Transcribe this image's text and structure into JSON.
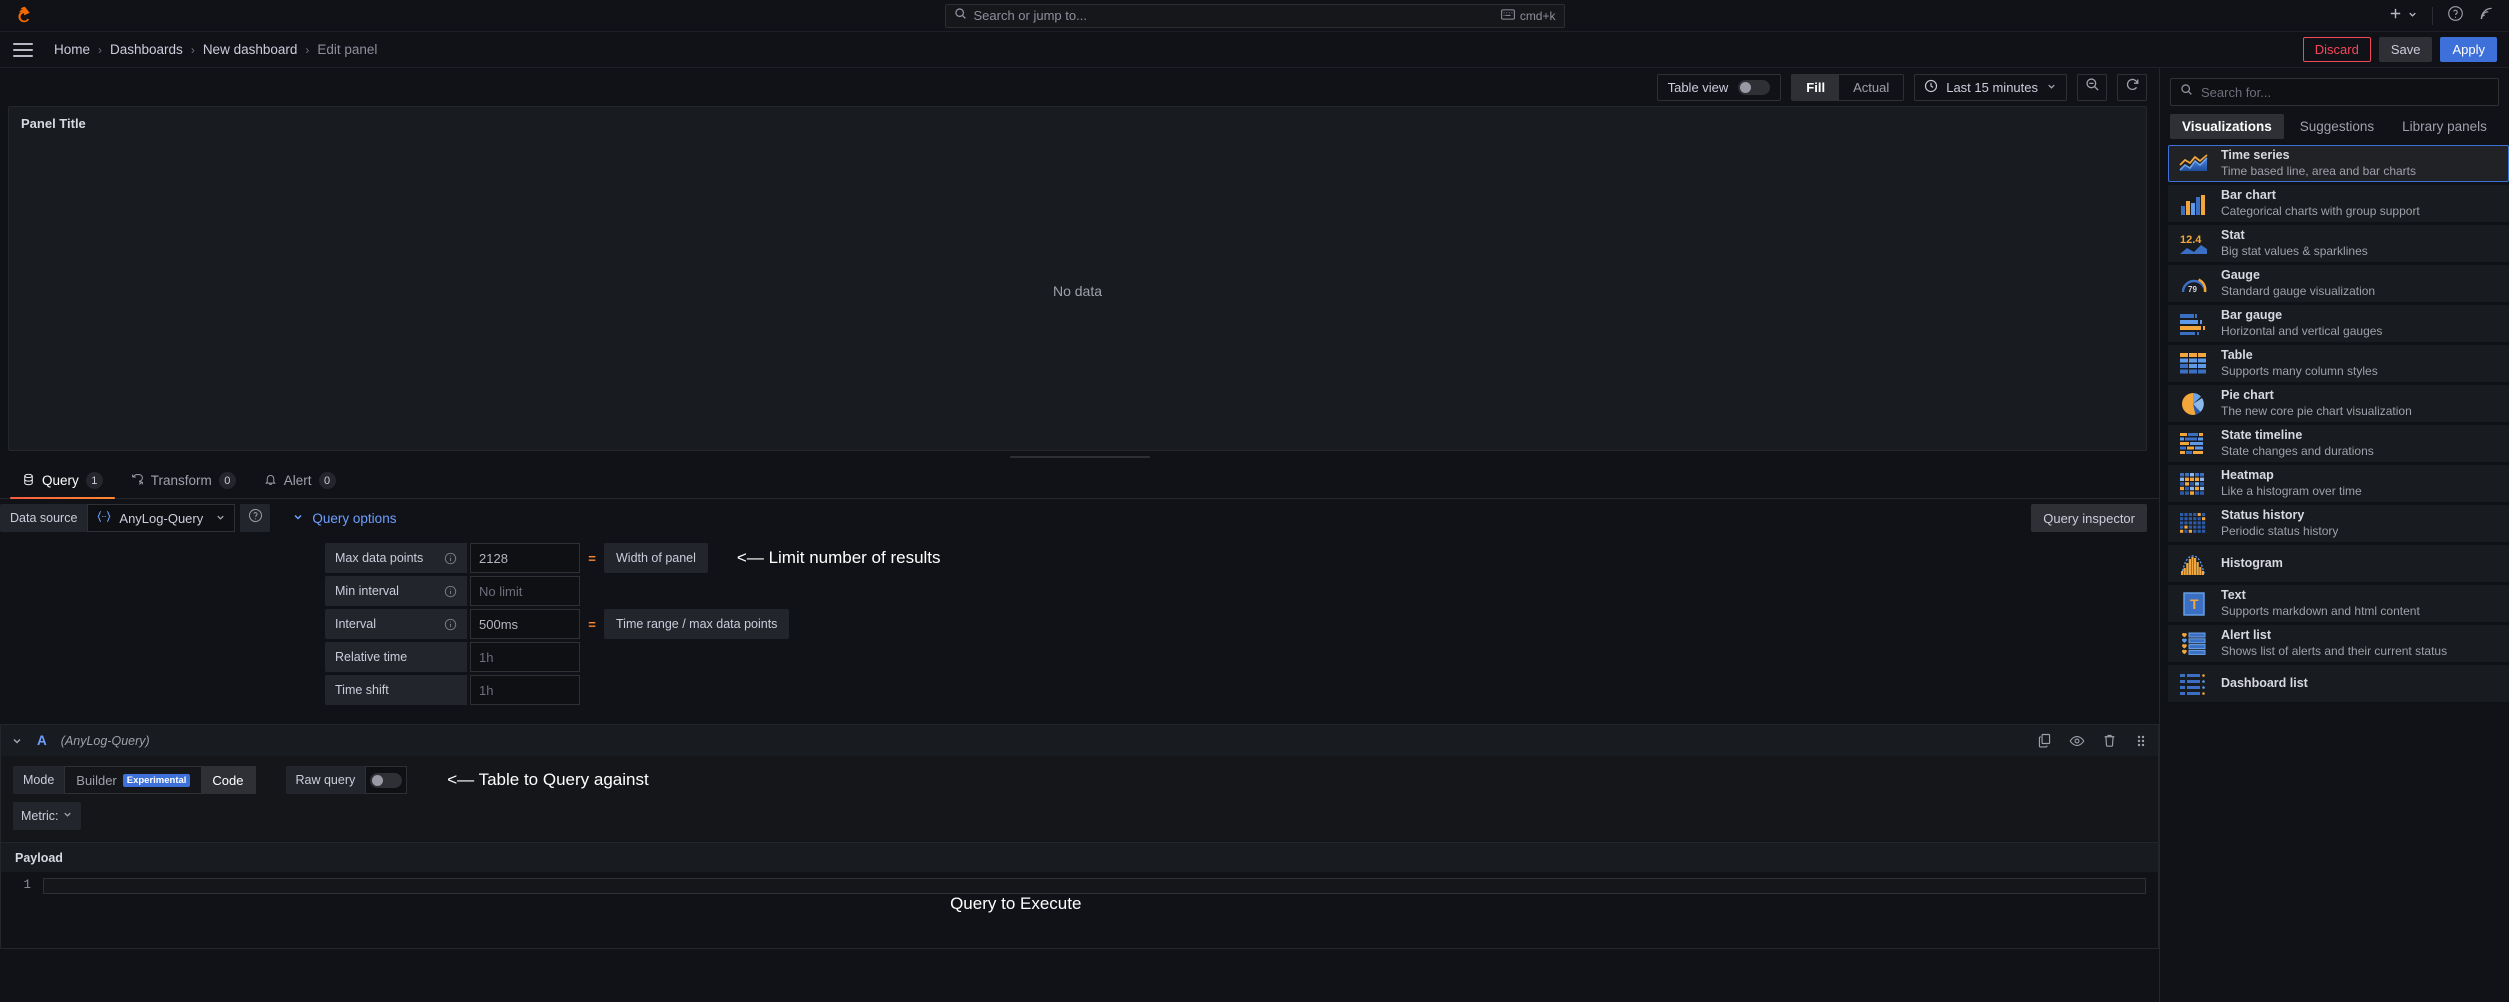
{
  "topbar": {
    "logo_icon": "grafana-logo-icon",
    "search": {
      "placeholder": "Search or jump to...",
      "icon": "search-icon",
      "shortcut": "cmd+k",
      "kbd_icon": "keyboard-icon"
    },
    "plus_label": "+",
    "help_icon": "help-circle-icon",
    "news_icon": "news-signal-icon"
  },
  "breadcrumb": {
    "menu_icon": "hamburger-menu-icon",
    "items": [
      {
        "label": "Home"
      },
      {
        "label": "Dashboards"
      },
      {
        "label": "New dashboard"
      },
      {
        "label": "Edit panel"
      }
    ],
    "separator": "›",
    "actions": {
      "discard": "Discard",
      "save": "Save",
      "apply": "Apply"
    }
  },
  "panel_toolbar": {
    "table_view_label": "Table view",
    "table_view_on": false,
    "fill_label": "Fill",
    "actual_label": "Actual",
    "selected_scale": "Fill",
    "time_range": "Last 15 minutes",
    "clock_icon": "clock-icon",
    "chevron_icon": "chevron-down-icon",
    "zoom_out_icon": "zoom-out-icon",
    "refresh_icon": "refresh-icon"
  },
  "panel": {
    "title": "Panel Title",
    "empty_state": "No data"
  },
  "tabs": [
    {
      "label": "Query",
      "badge": "1",
      "icon": "database-icon",
      "active": true
    },
    {
      "label": "Transform",
      "badge": "0",
      "icon": "transform-icon",
      "active": false
    },
    {
      "label": "Alert",
      "badge": "0",
      "icon": "bell-icon",
      "active": false
    }
  ],
  "datasource_row": {
    "label": "Data source",
    "value": "AnyLog-Query",
    "ds_icon": "braces-icon",
    "help_icon": "help-circle-icon",
    "query_options_label": "Query options",
    "query_inspector_label": "Query inspector"
  },
  "query_options": {
    "rows": [
      {
        "label": "Max data points",
        "value": "2128",
        "placeholder": "",
        "eq": "=",
        "desc": "Width of panel",
        "info_icon": "info-circle-icon"
      },
      {
        "label": "Min interval",
        "value": "",
        "placeholder": "No limit",
        "eq": "",
        "desc": "",
        "info_icon": "info-circle-icon"
      },
      {
        "label": "Interval",
        "value": "500ms",
        "placeholder": "",
        "eq": "=",
        "desc": "Time range / max data points",
        "info_icon": "info-circle-icon"
      },
      {
        "label": "Relative time",
        "value": "1h",
        "placeholder": "",
        "eq": "",
        "desc": "",
        "info_icon": ""
      },
      {
        "label": "Time shift",
        "value": "1h",
        "placeholder": "",
        "eq": "",
        "desc": "",
        "info_icon": ""
      }
    ],
    "annotation": "<— Limit number of results"
  },
  "query_a": {
    "ref_id": "A",
    "datasource": "(AnyLog-Query)",
    "collapse_icon": "chevron-down-icon",
    "actions": {
      "duplicate_icon": "copy-icon",
      "hide_icon": "eye-icon",
      "delete_icon": "trash-icon",
      "drag_icon": "drag-handle-icon"
    },
    "mode_label": "Mode",
    "builder_label": "Builder",
    "builder_badge": "Experimental",
    "code_label": "Code",
    "selected_mode": "Code",
    "raw_query_label": "Raw query",
    "raw_query_on": false,
    "metric_label": "Metric:",
    "payload_label": "Payload",
    "code_lines": [
      {
        "number": "1",
        "text": ""
      }
    ],
    "annotation_mode": "<— Table to Query against",
    "annotation_payload": "Query to Execute"
  },
  "viz_sidebar": {
    "search_placeholder": "Search for...",
    "search_icon": "search-icon",
    "tabs": [
      {
        "label": "Visualizations",
        "active": true
      },
      {
        "label": "Suggestions",
        "active": false
      },
      {
        "label": "Library panels",
        "active": false
      }
    ],
    "items": [
      {
        "name": "Time series",
        "desc": "Time based line, area and bar charts",
        "icon": "time-series-icon",
        "selected": true
      },
      {
        "name": "Bar chart",
        "desc": "Categorical charts with group support",
        "icon": "bar-chart-icon",
        "selected": false
      },
      {
        "name": "Stat",
        "desc": "Big stat values & sparklines",
        "icon": "stat-icon",
        "selected": false
      },
      {
        "name": "Gauge",
        "desc": "Standard gauge visualization",
        "icon": "gauge-icon",
        "selected": false
      },
      {
        "name": "Bar gauge",
        "desc": "Horizontal and vertical gauges",
        "icon": "bar-gauge-icon",
        "selected": false
      },
      {
        "name": "Table",
        "desc": "Supports many column styles",
        "icon": "table-icon",
        "selected": false
      },
      {
        "name": "Pie chart",
        "desc": "The new core pie chart visualization",
        "icon": "pie-chart-icon",
        "selected": false
      },
      {
        "name": "State timeline",
        "desc": "State changes and durations",
        "icon": "state-timeline-icon",
        "selected": false
      },
      {
        "name": "Heatmap",
        "desc": "Like a histogram over time",
        "icon": "heatmap-icon",
        "selected": false
      },
      {
        "name": "Status history",
        "desc": "Periodic status history",
        "icon": "status-history-icon",
        "selected": false
      },
      {
        "name": "Histogram",
        "desc": "",
        "icon": "histogram-icon",
        "selected": false
      },
      {
        "name": "Text",
        "desc": "Supports markdown and html content",
        "icon": "text-icon",
        "selected": false
      },
      {
        "name": "Alert list",
        "desc": "Shows list of alerts and their current status",
        "icon": "alert-list-icon",
        "selected": false
      },
      {
        "name": "Dashboard list",
        "desc": "",
        "icon": "dashboard-list-icon",
        "selected": false
      }
    ],
    "gauge_value": "79",
    "stat_value": "12.4"
  },
  "colors": {
    "accent_orange": "#f55f3e",
    "accent_blue": "#3d71d9",
    "danger_red": "#f2495c",
    "link_blue": "#6e9fff",
    "bg": "#111217",
    "panel_bg": "#181b1f"
  }
}
